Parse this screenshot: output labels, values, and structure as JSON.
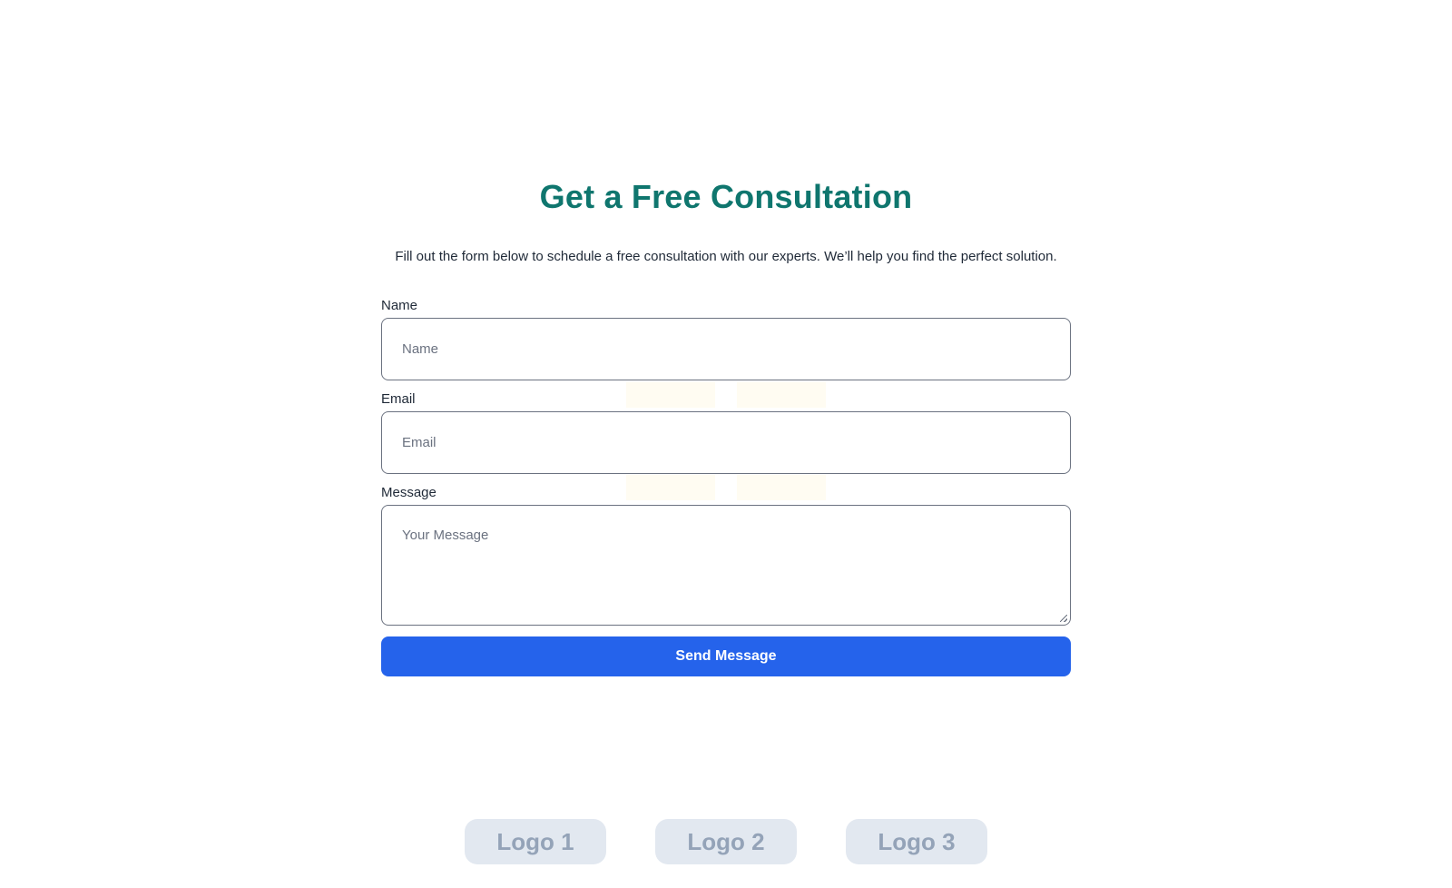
{
  "header": {
    "title": "Get a Free Consultation",
    "subtitle": "Fill out the form below to schedule a free consultation with our experts. We’ll help you find the perfect solution."
  },
  "form": {
    "name_label": "Name",
    "name_placeholder": "Name",
    "email_label": "Email",
    "email_placeholder": "Email",
    "message_label": "Message",
    "message_placeholder": "Your Message",
    "submit_label": "Send Message"
  },
  "logos": [
    "Logo 1",
    "Logo 2",
    "Logo 3"
  ],
  "colors": {
    "title": "#0f766e",
    "button": "#2563eb",
    "logo_bg": "#e2e8f0",
    "logo_text": "#94a3b8"
  }
}
